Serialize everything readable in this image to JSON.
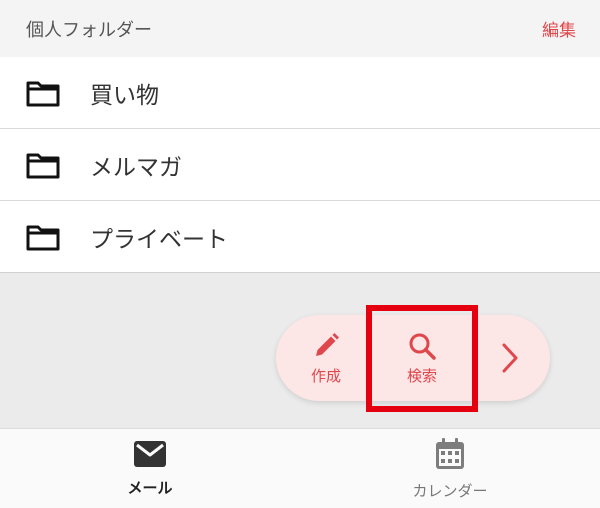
{
  "header": {
    "title": "個人フォルダー",
    "edit_label": "編集"
  },
  "folders": [
    {
      "label": "買い物",
      "icon": "folder-icon"
    },
    {
      "label": "メルマガ",
      "icon": "folder-icon"
    },
    {
      "label": "プライベート",
      "icon": "folder-icon"
    }
  ],
  "fab": {
    "compose_label": "作成",
    "compose_icon": "pencil-icon",
    "search_label": "検索",
    "search_icon": "search-icon",
    "next_icon": "chevron-right-icon"
  },
  "bottom_nav": {
    "mail_label": "メール",
    "mail_icon": "mail-icon",
    "calendar_label": "カレンダー",
    "calendar_icon": "calendar-icon"
  },
  "colors": {
    "accent": "#e0474c",
    "fab_background": "#fde6e6",
    "highlight": "#e4000f"
  }
}
